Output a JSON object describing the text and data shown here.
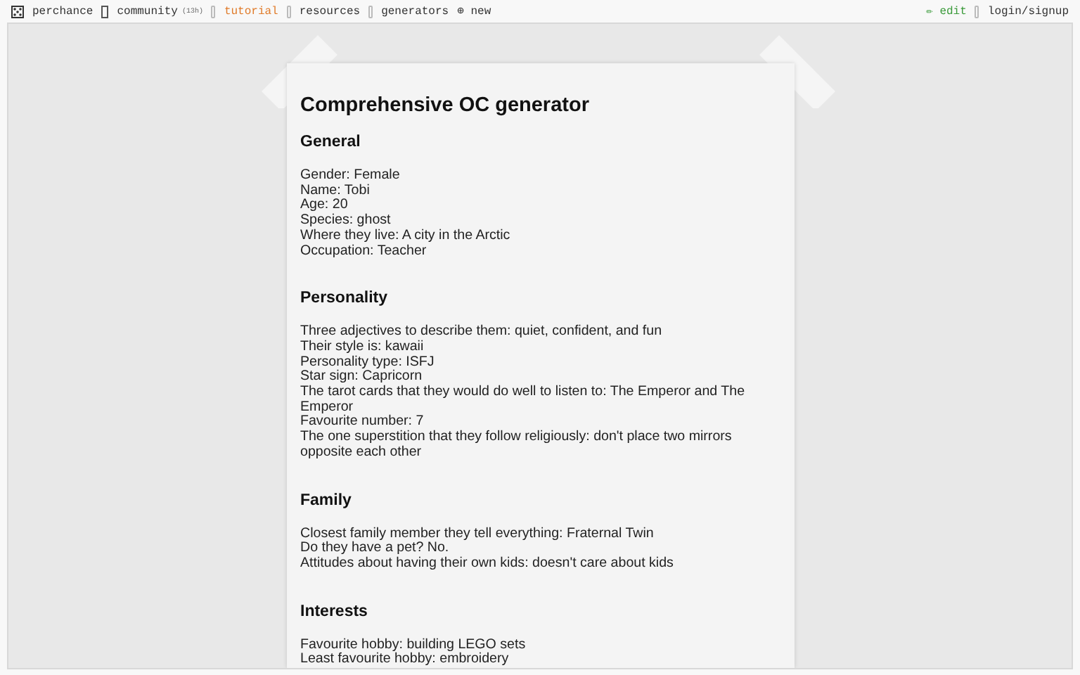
{
  "nav": {
    "left": [
      {
        "label": "perchance",
        "kind": "dice",
        "color": "#333333"
      },
      {
        "label": "community",
        "badge": "(13h)",
        "kind": "box",
        "color": "#333333"
      },
      {
        "label": "tutorial",
        "kind": "bar",
        "color": "#e07b2a"
      },
      {
        "label": "resources",
        "kind": "bar",
        "color": "#333333"
      },
      {
        "label": "generators",
        "kind": "bar",
        "color": "#333333"
      },
      {
        "label": "new",
        "glyph": "⊕",
        "color": "#333333"
      }
    ],
    "right": [
      {
        "label": "edit",
        "glyph": "✏",
        "color": "#3a9a3a"
      },
      {
        "label": "login/signup",
        "kind": "bar",
        "color": "#333333"
      }
    ]
  },
  "title": "Comprehensive OC generator",
  "sections": [
    {
      "heading": "General",
      "lines": [
        "Gender: Female",
        "Name: Tobi",
        "Age: 20",
        "Species: ghost",
        "Where they live: A city in the Arctic",
        "Occupation: Teacher"
      ]
    },
    {
      "heading": "Personality",
      "lines": [
        "Three adjectives to describe them: quiet, confident, and fun",
        "Their style is: kawaii",
        "Personality type: ISFJ",
        "Star sign: Capricorn",
        "The tarot cards that they would do well to listen to: The Emperor and The Emperor",
        "Favourite number: 7",
        "The one superstition that they follow religiously: don't place two mirrors opposite each other"
      ]
    },
    {
      "heading": "Family",
      "lines": [
        "Closest family member they tell everything: Fraternal Twin",
        "Do they have a pet? No.",
        "Attitudes about having their own kids: doesn't care about kids"
      ]
    },
    {
      "heading": "Interests",
      "lines": [
        "Favourite hobby: building LEGO sets",
        "Least favourite hobby: embroidery"
      ]
    }
  ]
}
